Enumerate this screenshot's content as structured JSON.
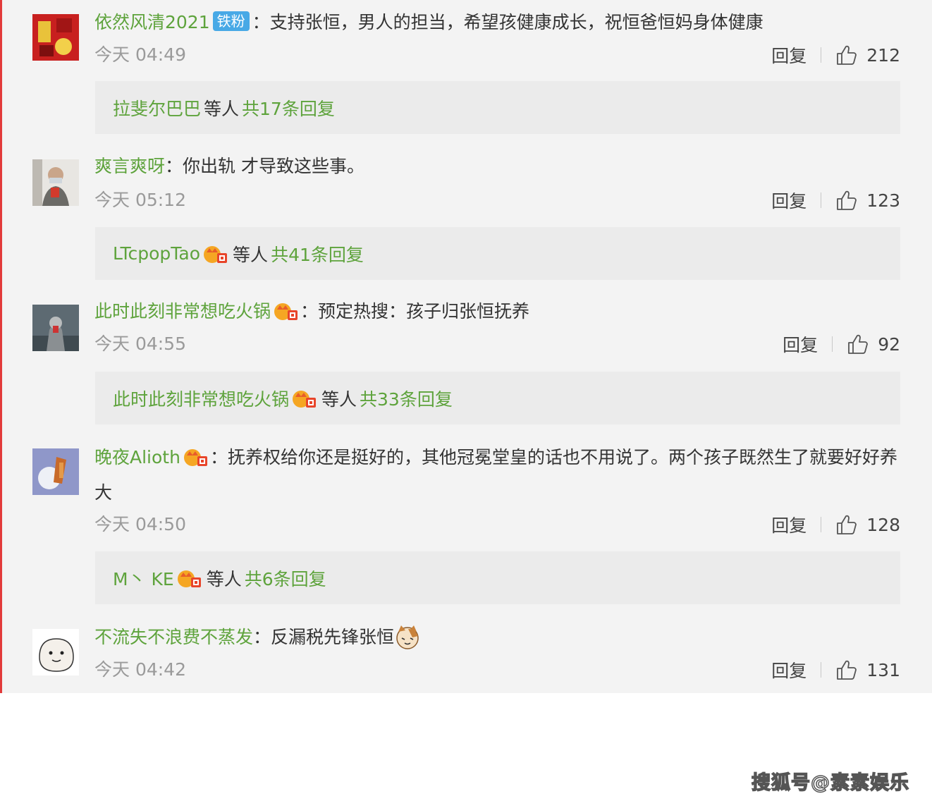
{
  "comments": [
    {
      "username": "依然风清2021",
      "badge": "铁粉",
      "sep": "：",
      "text": "支持张恒，男人的担当，希望孩健康成长，祝恒爸恒妈身体健康",
      "time": "今天 04:49",
      "reply_label": "回复",
      "likes": "212",
      "replies": {
        "name": "拉斐尔巴巴",
        "etc": "等人",
        "count": "共17条回复"
      }
    },
    {
      "username": "爽言爽呀",
      "sep": "：",
      "text": "你出轨 才导致这些事。",
      "time": "今天 05:12",
      "reply_label": "回复",
      "likes": "123",
      "replies": {
        "name": "LTcpopTao",
        "etc": "等人",
        "count": "共41条回复"
      }
    },
    {
      "username": "此时此刻非常想吃火锅",
      "sep": "：",
      "text": "预定热搜：孩子归张恒抚养",
      "time": "今天 04:55",
      "reply_label": "回复",
      "likes": "92",
      "replies": {
        "name": "此时此刻非常想吃火锅",
        "etc": "等人",
        "count": "共33条回复"
      }
    },
    {
      "username": "晚夜Alioth",
      "sep": "：",
      "text": "抚养权给你还是挺好的，其他冠冕堂皇的话也不用说了。两个孩子既然生了就要好好养大",
      "time": "今天 04:50",
      "reply_label": "回复",
      "likes": "128",
      "replies": {
        "name": "M丶 KE",
        "etc": "等人",
        "count": "共6条回复"
      }
    },
    {
      "username": "不流失不浪费不蒸发",
      "sep": "：",
      "text": "反漏税先锋张恒",
      "time": "今天 04:42",
      "reply_label": "回复",
      "likes": "131"
    }
  ],
  "watermark": "搜狐号@素素娱乐",
  "colors": {
    "username": "#5ea33c",
    "badge": "#48a9e6",
    "panel": "#f3f3f3",
    "reply_box": "#ebebeb",
    "left_rule": "#e23a3a"
  },
  "icons": {
    "like": "thumbs-up-icon",
    "vip": "vip-crown-icon",
    "emoji": "cat-emoji-icon"
  }
}
